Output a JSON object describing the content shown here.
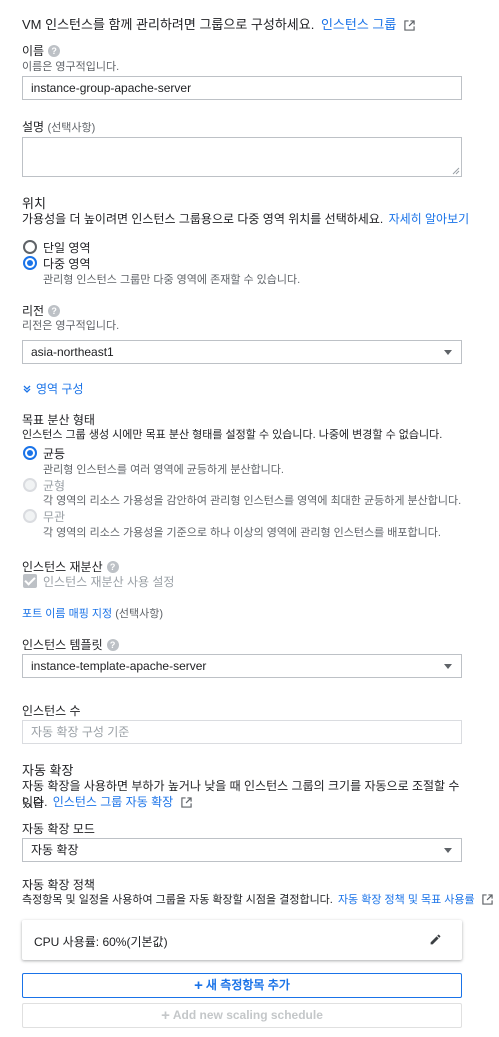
{
  "intro": {
    "text": "VM 인스턴스를 함께 관리하려면 그룹으로 구성하세요.",
    "link": "인스턴스 그룹"
  },
  "name": {
    "label": "이름",
    "hint": "이름은 영구적입니다.",
    "value": "instance-group-apache-server"
  },
  "description": {
    "label": "설명",
    "optional": "(선택사항)"
  },
  "location": {
    "label": "위치",
    "hint": "가용성을 더 높이려면 인스턴스 그룹용으로 다중 영역 위치를 선택하세요.",
    "link": "자세히 알아보기",
    "options": [
      {
        "label": "단일 영역",
        "selected": false
      },
      {
        "label": "다중 영역",
        "selected": true,
        "sub": "관리형 인스턴스 그룹만 다중 영역에 존재할 수 있습니다."
      }
    ]
  },
  "region": {
    "label": "리전",
    "hint": "리전은 영구적입니다.",
    "value": "asia-northeast1"
  },
  "zone_config": {
    "label": "영역 구성"
  },
  "distribution": {
    "label": "목표 분산 형태",
    "hint": "인스턴스 그룹 생성 시에만 목표 분산 형태를 설정할 수 있습니다. 나중에 변경할 수 없습니다.",
    "options": [
      {
        "label": "균등",
        "sub": "관리형 인스턴스를 여러 영역에 균등하게 분산합니다.",
        "selected": true,
        "disabled": false
      },
      {
        "label": "균형",
        "sub": "각 영역의 리소스 가용성을 감안하여 관리형 인스턴스를 영역에 최대한 균등하게 분산합니다.",
        "selected": false,
        "disabled": true
      },
      {
        "label": "무관",
        "sub": "각 영역의 리소스 가용성을 기준으로 하나 이상의 영역에 관리형 인스턴스를 배포합니다.",
        "selected": false,
        "disabled": true
      }
    ]
  },
  "redistribution": {
    "label": "인스턴스 재분산",
    "checkbox_label": "인스턴스 재분산 사용 설정",
    "checked": true
  },
  "port_mapping": {
    "link": "포트 이름 매핑 지정",
    "optional": "(선택사항)"
  },
  "template": {
    "label": "인스턴스 템플릿",
    "value": "instance-template-apache-server"
  },
  "instance_count": {
    "label": "인스턴스 수",
    "placeholder": "자동 확장 구성 기준"
  },
  "autoscaling": {
    "label": "자동 확장",
    "hint_line1": "자동 확장을 사용하면 부하가 높거나 낮을 때 인스턴스 그룹의 크기를 자동으로 조절할 수 있습",
    "hint_line2": "니다.",
    "link": "인스턴스 그룹 자동 확장"
  },
  "autoscaling_mode": {
    "label": "자동 확장 모드",
    "value": "자동 확장"
  },
  "autoscaling_policy": {
    "label": "자동 확장 정책",
    "hint": "측정항목 및 일정을 사용하여 그룹을 자동 확장할 시점을 결정합니다.",
    "link": "자동 확장 정책 및 목표 사용률",
    "metric": "CPU 사용률: 60%(기본값)"
  },
  "buttons": {
    "add_metric": "새 측정항목 추가",
    "add_schedule": "Add new scaling schedule"
  },
  "colors": {
    "accent": "#1a73e8",
    "text": "#202124",
    "muted": "#5f6368",
    "disabled": "#c4c7c9"
  }
}
